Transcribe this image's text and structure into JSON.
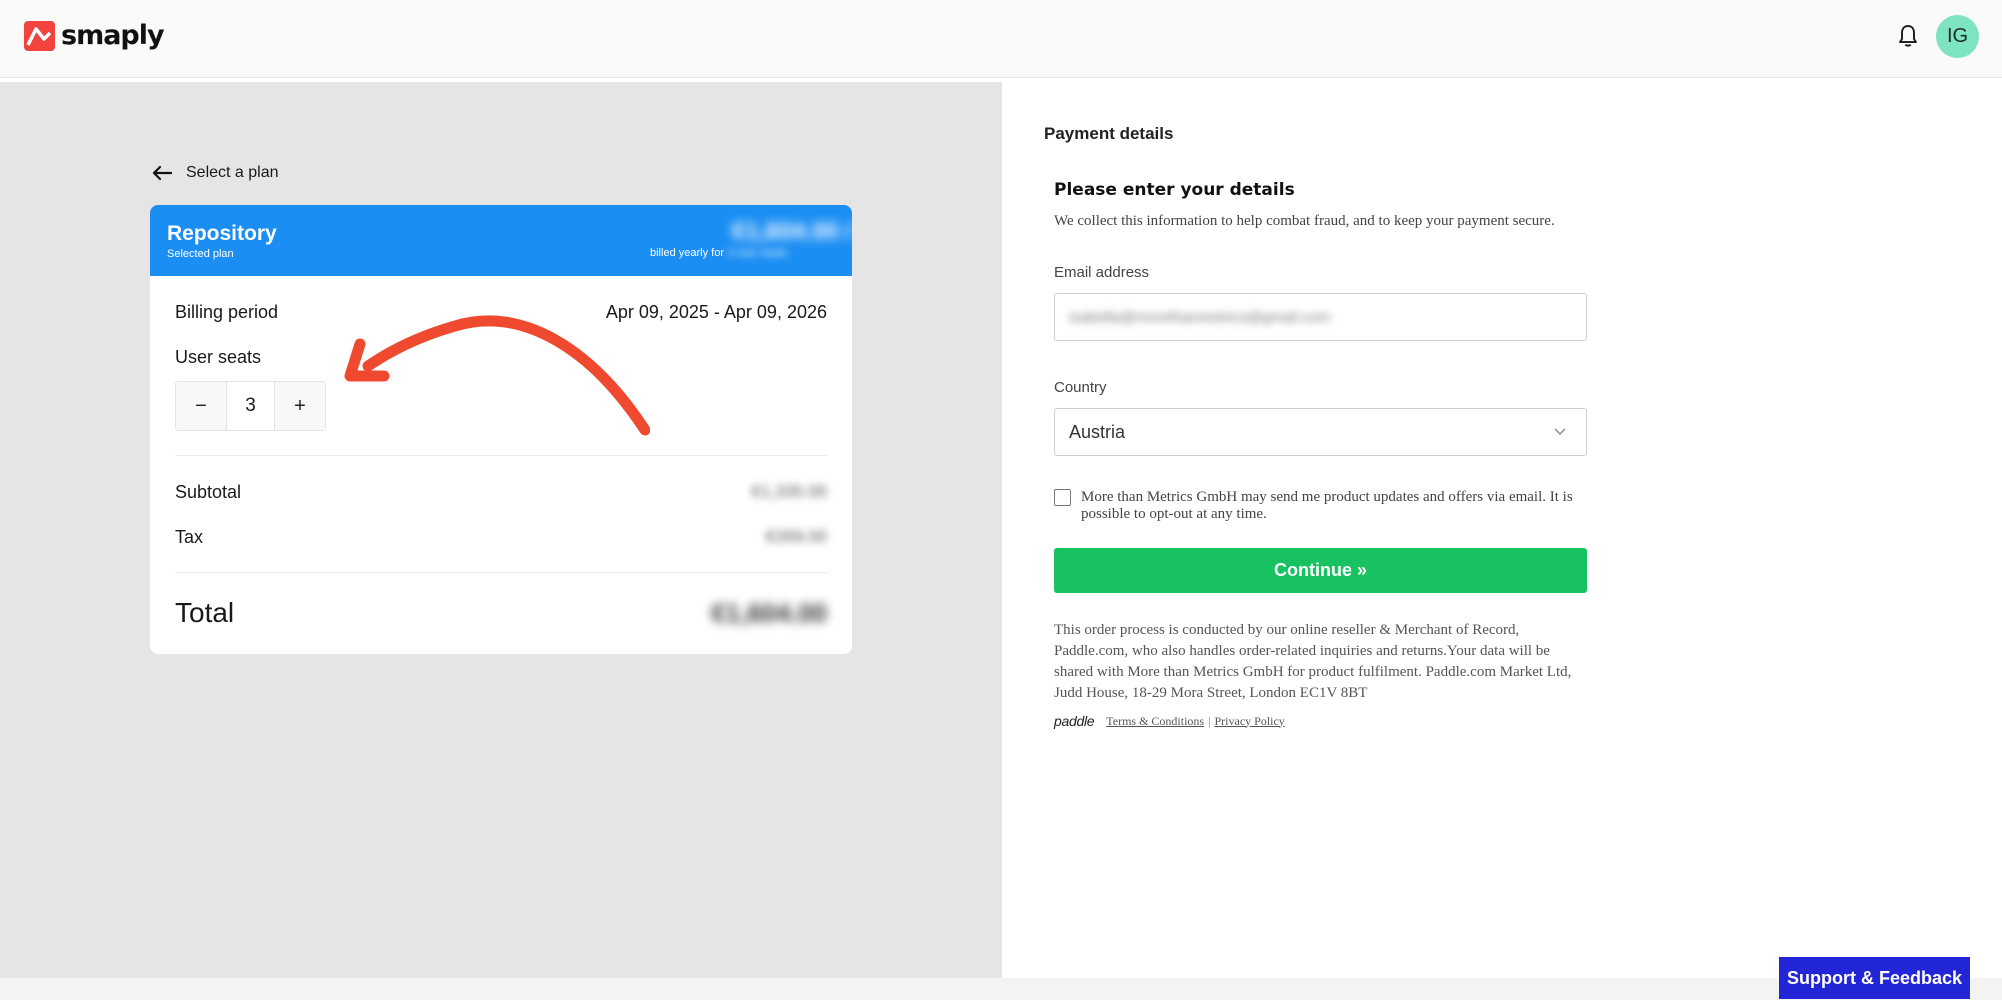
{
  "header": {
    "logo_text": "smaply",
    "avatar_initials": "IG",
    "accent_color": "#f2443d",
    "avatar_color": "#7ee4c0"
  },
  "plan": {
    "back_label": "Select a plan",
    "name": "Repository",
    "subtitle": "Selected plan",
    "price": "€1,604.00 / yr",
    "billed_prefix": "billed yearly for",
    "billed_amount": "3 user seats",
    "billing_period_label": "Billing period",
    "billing_period_value": "Apr 09, 2025 - Apr 09, 2026",
    "seats_label": "User seats",
    "seats_value": "3",
    "minus_label": "−",
    "plus_label": "+",
    "subtotal_label": "Subtotal",
    "subtotal_value": "€1,335.00",
    "tax_label": "Tax",
    "tax_value": "€269.00",
    "total_label": "Total",
    "total_value": "€1,604.00",
    "header_color": "#1b8ef3"
  },
  "payment": {
    "section_title": "Payment details",
    "form_title": "Please enter your details",
    "form_desc": "We collect this information to help combat fraud, and to keep your payment secure.",
    "email_label": "Email address",
    "email_value": "isabella@morethanmetrics@gmail.com",
    "country_label": "Country",
    "country_value": "Austria",
    "consent_text": "More than Metrics GmbH may send me product updates and offers via email. It is possible to opt-out at any time.",
    "continue_label": "Continue »",
    "order_note": "This order process is conducted by our online reseller & Merchant of Record, Paddle.com, who also handles order-related inquiries and returns.Your data will be shared with More than Metrics GmbH for product fulfilment. Paddle.com Market Ltd, Judd House, 18-29 Mora Street, London EC1V 8BT",
    "paddle_logo": "paddle",
    "terms_label": "Terms & Conditions",
    "separator": "|",
    "privacy_label": "Privacy Policy",
    "continue_color": "#18c260"
  },
  "support": {
    "label": "Support & Feedback",
    "color": "#2226d6"
  },
  "icons": [
    "smaply-logo-icon",
    "bell-icon",
    "back-arrow-icon",
    "chevron-down-icon",
    "annotation-arrow-icon"
  ]
}
